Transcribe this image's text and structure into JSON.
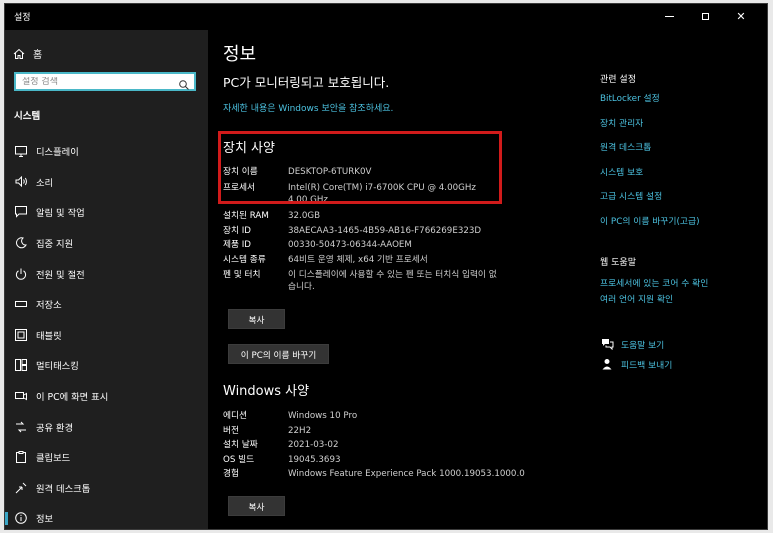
{
  "window": {
    "title": "설정"
  },
  "sidebar": {
    "home_label": "홈",
    "search_placeholder": "설정 검색",
    "section": "시스템",
    "items": [
      {
        "label": "디스플레이",
        "icon": "display-icon"
      },
      {
        "label": "소리",
        "icon": "sound-icon"
      },
      {
        "label": "알림 및 작업",
        "icon": "notifications-icon"
      },
      {
        "label": "집중 지원",
        "icon": "focus-assist-icon"
      },
      {
        "label": "전원 및 절전",
        "icon": "power-icon"
      },
      {
        "label": "저장소",
        "icon": "storage-icon"
      },
      {
        "label": "태블릿",
        "icon": "tablet-icon"
      },
      {
        "label": "멀티태스킹",
        "icon": "multitasking-icon"
      },
      {
        "label": "이 PC에 화면 표시",
        "icon": "project-icon"
      },
      {
        "label": "공유 환경",
        "icon": "shared-experiences-icon"
      },
      {
        "label": "클립보드",
        "icon": "clipboard-icon"
      },
      {
        "label": "원격 데스크톱",
        "icon": "remote-desktop-icon"
      },
      {
        "label": "정보",
        "icon": "info-icon"
      }
    ]
  },
  "main": {
    "title": "정보",
    "protect_text": "PC가 모니터링되고 보호됩니다.",
    "security_link": "자세한 내용은 Windows 보안을 참조하세요.",
    "device_heading": "장치 사양",
    "device_specs": [
      {
        "key": "장치 이름",
        "value": "DESKTOP-6TURK0V"
      },
      {
        "key": "프로세서",
        "value": "Intel(R) Core(TM) i7-6700K CPU @ 4.00GHz   4.00 GHz"
      },
      {
        "key": "설치된 RAM",
        "value": "32.0GB"
      },
      {
        "key": "장치 ID",
        "value": "38AECAA3-1465-4B59-AB16-F766269E323D"
      },
      {
        "key": "제품 ID",
        "value": "00330-50473-06344-AAOEM"
      },
      {
        "key": "시스템 종류",
        "value": "64비트 운영 체제, x64 기반 프로세서"
      },
      {
        "key": "펜 및 터치",
        "value": "이 디스플레이에 사용할 수 있는 펜 또는 터치식 입력이 없습니다."
      }
    ],
    "copy_button": "복사",
    "rename_button": "이 PC의 이름 바꾸기",
    "windows_heading": "Windows 사양",
    "windows_specs": [
      {
        "key": "에디션",
        "value": "Windows 10 Pro"
      },
      {
        "key": "버전",
        "value": "22H2"
      },
      {
        "key": "설치 날짜",
        "value": "2021-03-02"
      },
      {
        "key": "OS 빌드",
        "value": "19045.3693"
      },
      {
        "key": "경험",
        "value": "Windows Feature Experience Pack 1000.19053.1000.0"
      }
    ],
    "copy_button_2": "복사"
  },
  "related": {
    "title": "관련 설정",
    "links": [
      "BitLocker 설정",
      "장치 관리자",
      "원격 데스크톱",
      "시스템 보호",
      "고급 시스템 설정",
      "이 PC의 이름 바꾸기(고급)"
    ]
  },
  "help": {
    "title": "웹 도움말",
    "links": [
      "프로세서에 있는 코어 수 확인",
      "여러 언어 지원 확인"
    ],
    "get_help": "도움말 보기",
    "feedback": "피드백 보내기"
  },
  "colors": {
    "accent": "#4cc2e0",
    "highlight_box": "#d11b1b",
    "sidebar_bg": "#1f1f1f"
  }
}
